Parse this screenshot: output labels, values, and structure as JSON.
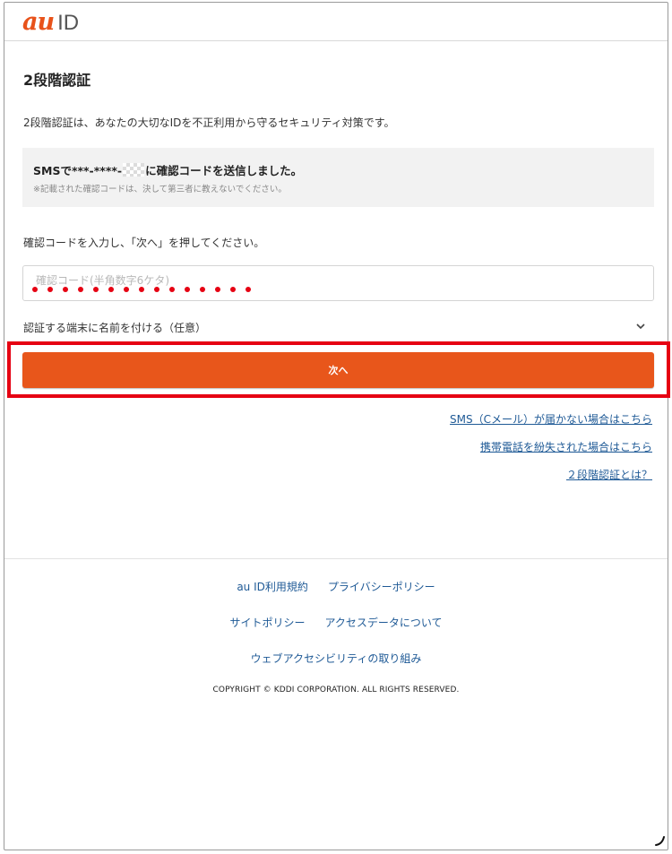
{
  "header": {
    "logo_au": "au",
    "logo_id": "ID"
  },
  "main": {
    "title": "2段階認証",
    "intro": "2段階認証は、あなたの大切なIDを不正利用から守るセキュリティ対策です。",
    "sms_box": {
      "prefix": "SMSで***-****-",
      "suffix": "に確認コードを送信しました。",
      "note": "※記載された確認コードは、決して第三者に教えないでください。"
    },
    "instruction": "確認コードを入力し、「次へ」を押してください。",
    "code_input": {
      "placeholder": "確認コード(半角数字6ケタ)",
      "value": ""
    },
    "device_name_toggle": "認証する端末に名前を付ける（任意）",
    "next_button": "次へ",
    "links": [
      "SMS（Cメール）が届かない場合はこちら",
      "携帯電話を紛失された場合はこちら",
      "２段階認証とは？"
    ]
  },
  "footer": {
    "links": [
      "au ID利用規約",
      "プライバシーポリシー",
      "サイトポリシー",
      "アクセスデータについて",
      "ウェブアクセシビリティの取り組み"
    ],
    "copyright": "COPYRIGHT © KDDI CORPORATION. ALL RIGHTS RESERVED."
  },
  "colors": {
    "brand_orange": "#e8561b",
    "highlight_red": "#e60012",
    "link_blue": "#1f5a96"
  },
  "icons": [
    "chevron-down-icon",
    "resize-corner-icon"
  ]
}
